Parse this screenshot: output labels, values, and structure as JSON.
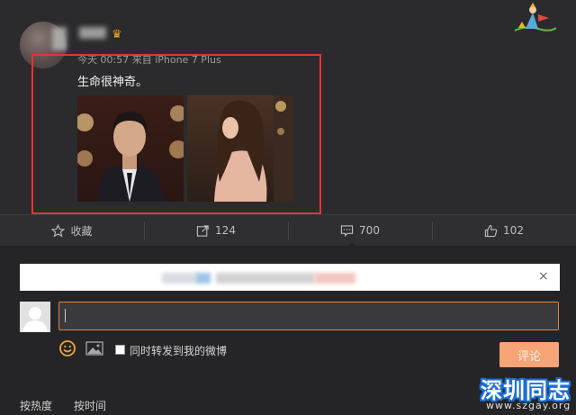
{
  "post": {
    "crown_glyph": "♛",
    "meta": "今天 00:57 来自 iPhone 7 Plus",
    "text": "生命很神奇。"
  },
  "actions": {
    "favorite": {
      "icon": "star-icon",
      "label": "收藏"
    },
    "repost": {
      "icon": "share-arrow-icon",
      "label": "124"
    },
    "comment": {
      "icon": "comment-icon",
      "label": "700"
    },
    "like": {
      "icon": "thumbs-up-icon",
      "label": "102"
    }
  },
  "banner": {
    "close": "×"
  },
  "comment_box": {
    "sync_label": "同时转发到我的微博",
    "submit_label": "评论",
    "sync_checked": false
  },
  "sort": {
    "by_hot": "按热度",
    "by_time": "按时间"
  },
  "watermark": {
    "title": "深圳同志",
    "url": "www.szgay.org"
  },
  "colors": {
    "highlight": "#e0353a",
    "accent": "#e2844a",
    "submit": "#f7a477",
    "watermark_blue": "#1d6fd6"
  }
}
